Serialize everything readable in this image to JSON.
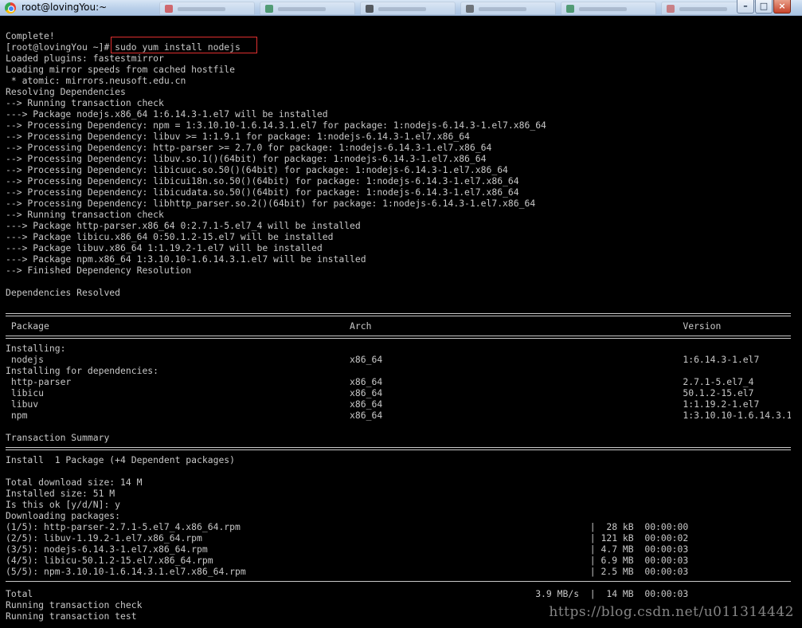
{
  "window": {
    "title": "root@lovingYou:~",
    "controls": {
      "minimize": "–",
      "maximize": "□",
      "close": "×"
    },
    "background_tabs": [
      {
        "icon_color": "#d64545"
      },
      {
        "icon_color": "#2f8a4f"
      },
      {
        "icon_color": "#333333"
      },
      {
        "icon_color": "#555555"
      },
      {
        "icon_color": "#2f8a4f"
      },
      {
        "icon_color": "#cc6666"
      }
    ]
  },
  "terminal": {
    "colors": {
      "background": "#000000",
      "text": "#c8c8c8",
      "highlight_box": "#e03030"
    },
    "lines": [
      "Complete!",
      "[root@lovingYou ~]# sudo yum install nodejs",
      "Loaded plugins: fastestmirror",
      "Loading mirror speeds from cached hostfile",
      " * atomic: mirrors.neusoft.edu.cn",
      "Resolving Dependencies",
      "--> Running transaction check",
      "---> Package nodejs.x86_64 1:6.14.3-1.el7 will be installed",
      "--> Processing Dependency: npm = 1:3.10.10-1.6.14.3.1.el7 for package: 1:nodejs-6.14.3-1.el7.x86_64",
      "--> Processing Dependency: libuv >= 1:1.9.1 for package: 1:nodejs-6.14.3-1.el7.x86_64",
      "--> Processing Dependency: http-parser >= 2.7.0 for package: 1:nodejs-6.14.3-1.el7.x86_64",
      "--> Processing Dependency: libuv.so.1()(64bit) for package: 1:nodejs-6.14.3-1.el7.x86_64",
      "--> Processing Dependency: libicuuc.so.50()(64bit) for package: 1:nodejs-6.14.3-1.el7.x86_64",
      "--> Processing Dependency: libicui18n.so.50()(64bit) for package: 1:nodejs-6.14.3-1.el7.x86_64",
      "--> Processing Dependency: libicudata.so.50()(64bit) for package: 1:nodejs-6.14.3-1.el7.x86_64",
      "--> Processing Dependency: libhttp_parser.so.2()(64bit) for package: 1:nodejs-6.14.3-1.el7.x86_64",
      "--> Running transaction check",
      "---> Package http-parser.x86_64 0:2.7.1-5.el7_4 will be installed",
      "---> Package libicu.x86_64 0:50.1.2-15.el7 will be installed",
      "---> Package libuv.x86_64 1:1.19.2-1.el7 will be installed",
      "---> Package npm.x86_64 1:3.10.10-1.6.14.3.1.el7 will be installed",
      "--> Finished Dependency Resolution",
      "",
      "Dependencies Resolved",
      "",
      "RULE",
      " Package                                                       Arch                                                         Version",
      "RULE",
      "Installing:",
      " nodejs                                                        x86_64                                                       1:6.14.3-1.el7",
      "Installing for dependencies:",
      " http-parser                                                   x86_64                                                       2.7.1-5.el7_4",
      " libicu                                                        x86_64                                                       50.1.2-15.el7",
      " libuv                                                         x86_64                                                       1:1.19.2-1.el7",
      " npm                                                           x86_64                                                       1:3.10.10-1.6.14.3.1.el7",
      "",
      "Transaction Summary",
      "RULE",
      "Install  1 Package (+4 Dependent packages)",
      "",
      "Total download size: 14 M",
      "Installed size: 51 M",
      "Is this ok [y/d/N]: y",
      "Downloading packages:",
      "(1/5): http-parser-2.7.1-5.el7_4.x86_64.rpm                                                                |  28 kB  00:00:00",
      "(2/5): libuv-1.19.2-1.el7.x86_64.rpm                                                                       | 121 kB  00:00:02",
      "(3/5): nodejs-6.14.3-1.el7.x86_64.rpm                                                                      | 4.7 MB  00:00:03",
      "(4/5): libicu-50.1.2-15.el7.x86_64.rpm                                                                     | 6.9 MB  00:00:03",
      "(5/5): npm-3.10.10-1.6.14.3.1.el7.x86_64.rpm                                                               | 2.5 MB  00:00:03",
      "RULE_THIN",
      "Total                                                                                            3.9 MB/s  |  14 MB  00:00:03",
      "Running transaction check",
      "Running transaction test"
    ]
  },
  "watermark": "https://blog.csdn.net/u011314442"
}
